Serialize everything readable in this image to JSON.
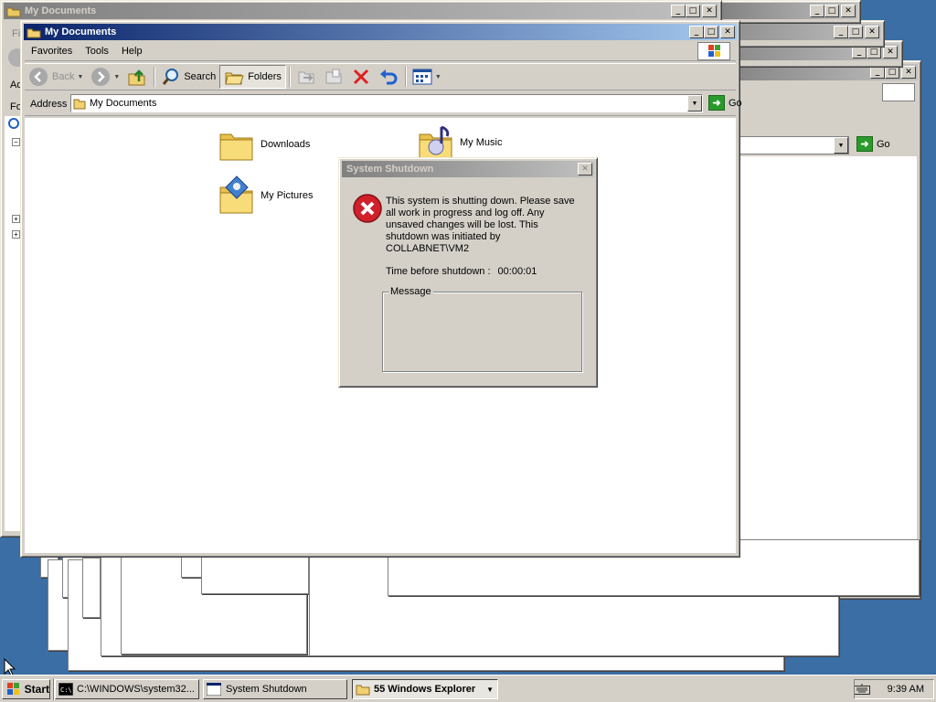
{
  "windows": {
    "back_title": "My Documents",
    "main_title": "My Documents"
  },
  "menu": [
    "Favorites",
    "Tools",
    "Help"
  ],
  "left_edge": {
    "menu_fragment": "Fi",
    "toolbar_fragment": "Ad",
    "folders_fragment": "Fo"
  },
  "toolbar": {
    "back": "Back",
    "search": "Search",
    "folders": "Folders"
  },
  "address": {
    "label": "Address",
    "value": "My Documents",
    "go": "Go"
  },
  "folders": [
    {
      "name": "Downloads",
      "icon": "folder-icon"
    },
    {
      "name": "My Music",
      "icon": "music-folder-icon"
    },
    {
      "name": "My Pictures",
      "icon": "pictures-folder-icon"
    }
  ],
  "dialog": {
    "title": "System Shutdown",
    "message": "This system is shutting down. Please save all work in progress and log off. Any unsaved changes will be lost. This shutdown was initiated by COLLABNET\\VM2",
    "time_label": "Time before shutdown :",
    "time_value": "00:00:01",
    "message_group": "Message"
  },
  "taskbar": {
    "start": "Start",
    "items": [
      {
        "label": "C:\\WINDOWS\\system32...",
        "icon": "cmd-icon"
      },
      {
        "label": "System Shutdown",
        "icon": "window-icon"
      },
      {
        "label": "55 Windows Explorer",
        "icon": "folder-icon"
      }
    ],
    "clock": "9:39 AM"
  },
  "colors": {
    "desktop": "#3a6ea5",
    "active_title": "#0a246a",
    "dialog_error": "#d0202a"
  }
}
